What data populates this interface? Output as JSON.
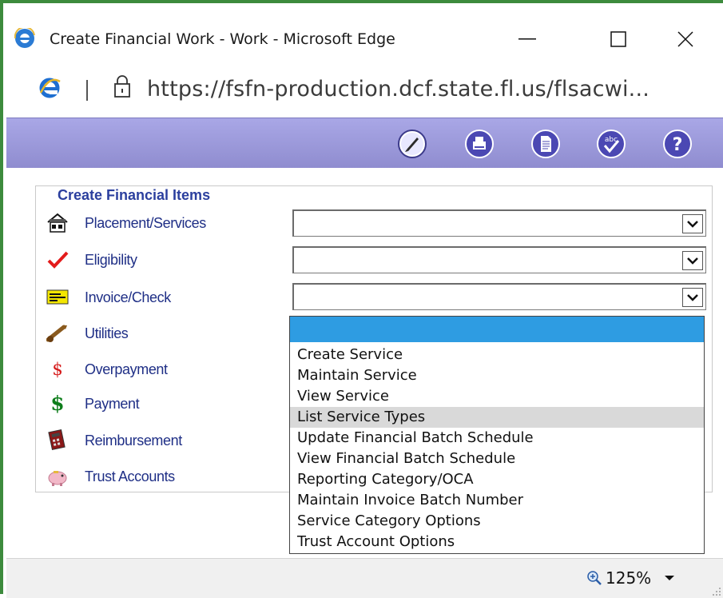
{
  "window": {
    "title": "Create Financial Work - Work - Microsoft Edge",
    "url": "https://fsfn-production.dcf.state.fl.us/flsacwi...",
    "url_host": "fsfn-production.dcf.state.fl.us"
  },
  "toolbar": {
    "buttons": [
      "edit-icon",
      "print-icon",
      "document-icon",
      "spellcheck-icon",
      "help-icon"
    ],
    "help_label": "?",
    "spell_label": "abc"
  },
  "financial_items": {
    "legend": "Create Financial Items",
    "items": [
      {
        "label": "Placement/Services",
        "icon": "house-icon"
      },
      {
        "label": "Eligibility",
        "icon": "checkmark-icon"
      },
      {
        "label": "Invoice/Check",
        "icon": "invoice-icon"
      },
      {
        "label": "Utilities",
        "icon": "wrench-icon"
      },
      {
        "label": "Overpayment",
        "icon": "dollar-red-icon",
        "glyph": "$"
      },
      {
        "label": "Payment",
        "icon": "dollar-green-icon",
        "glyph": "$"
      },
      {
        "label": "Reimbursement",
        "icon": "calculator-icon"
      },
      {
        "label": "Trust Accounts",
        "icon": "piggy-bank-icon"
      }
    ]
  },
  "dropdown": {
    "options": [
      "Create Service",
      "Maintain Service",
      "View Service",
      "List Service Types",
      "Update Financial Batch Schedule",
      "View Financial Batch Schedule",
      "Reporting Category/OCA",
      "Maintain Invoice Batch Number",
      "Service Category Options",
      "Trust Account Options"
    ],
    "hovered_index": 3
  },
  "status": {
    "zoom": "125%"
  },
  "colors": {
    "toolbar": "#9c9adb",
    "link": "#1f2f86",
    "legend": "#2b3f9e",
    "selection": "#2e9ce2",
    "frame": "#3d8b3d"
  }
}
